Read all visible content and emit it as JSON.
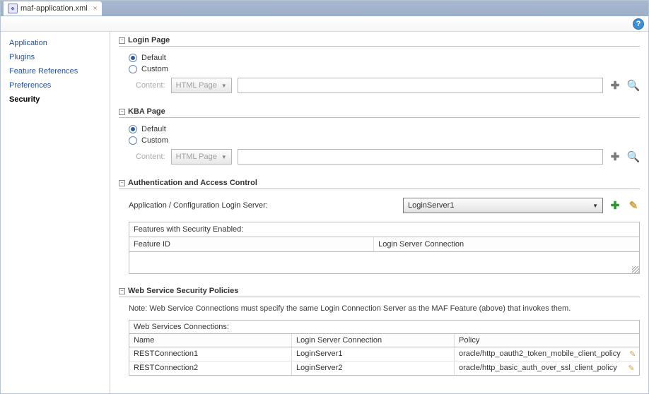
{
  "tab": {
    "title": "maf-application.xml",
    "close": "×"
  },
  "help_glyph": "?",
  "sidebar": [
    "Application",
    "Plugins",
    "Feature References",
    "Preferences",
    "Security"
  ],
  "login_section": {
    "title": "Login Page",
    "radio_default": "Default",
    "radio_custom": "Custom",
    "content_label": "Content:",
    "content_type": "HTML Page"
  },
  "kba_section": {
    "title": "KBA Page",
    "radio_default": "Default",
    "radio_custom": "Custom",
    "content_label": "Content:",
    "content_type": "HTML Page"
  },
  "auth_section": {
    "title": "Authentication and Access Control",
    "server_label": "Application / Configuration Login Server:",
    "server_value": "LoginServer1",
    "features_caption": "Features with Security Enabled:",
    "col_feature": "Feature ID",
    "col_login": "Login Server Connection"
  },
  "ws_section": {
    "title": "Web Service Security Policies",
    "note": "Note: Web Service Connections must specify the same Login Connection Server as the MAF Feature (above) that invokes them.",
    "caption": "Web Services Connections:",
    "col_name": "Name",
    "col_login": "Login Server Connection",
    "col_policy": "Policy",
    "rows": [
      {
        "name": "RESTConnection1",
        "login": "LoginServer1",
        "policy": "oracle/http_oauth2_token_mobile_client_policy"
      },
      {
        "name": "RESTConnection2",
        "login": "LoginServer2",
        "policy": "oracle/http_basic_auth_over_ssl_client_policy"
      }
    ]
  }
}
